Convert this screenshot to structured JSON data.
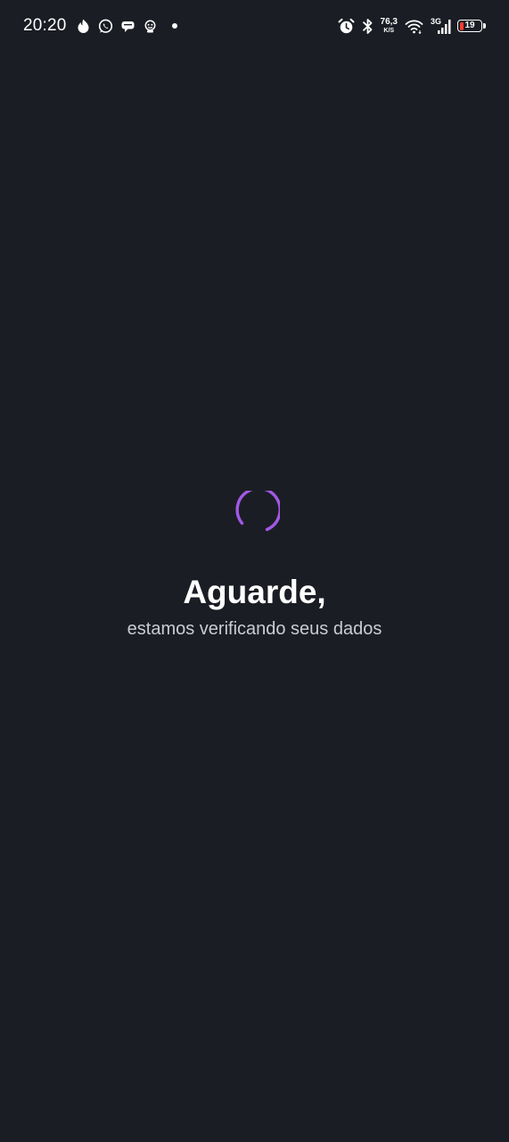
{
  "status_bar": {
    "time": "20:20",
    "notification_icons": [
      "flame-icon",
      "whatsapp-icon",
      "chat-bubbles-icon",
      "sticker-icon"
    ],
    "network_speed": {
      "value": "76,3",
      "unit": "K/S"
    },
    "network_type": "3G",
    "battery": {
      "level": "19",
      "fraction": 0.19,
      "color": "#ff3b30"
    }
  },
  "loading": {
    "title": "Aguarde,",
    "subtitle": "estamos verificando seus dados",
    "spinner_color": "#a259e6"
  },
  "colors": {
    "background": "#1b1d24",
    "text_primary": "#ffffff",
    "text_secondary": "#c9ccd4"
  }
}
